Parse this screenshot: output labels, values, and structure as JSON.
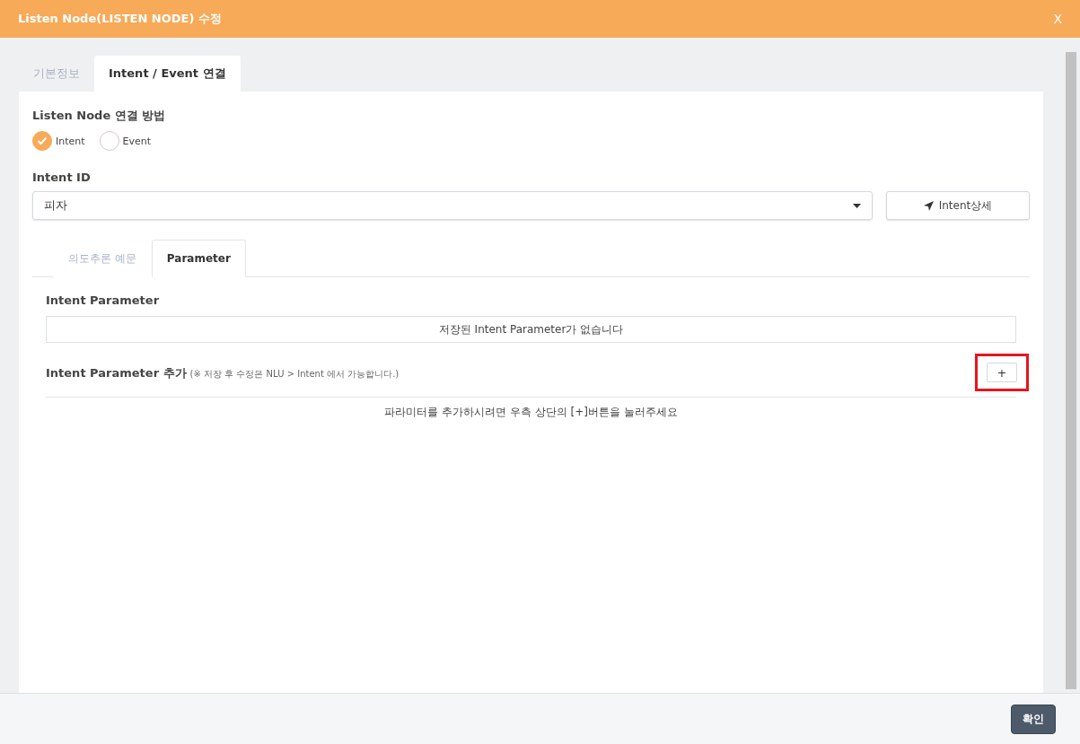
{
  "window": {
    "title": "Listen Node(LISTEN NODE) 수정",
    "close": "X"
  },
  "tabs": [
    {
      "label": "기본정보",
      "selected": false
    },
    {
      "label": "Intent / Event 연결",
      "selected": true
    }
  ],
  "connection": {
    "label": "Listen Node 연결 방법",
    "options": [
      {
        "label": "Intent",
        "selected": true
      },
      {
        "label": "Event",
        "selected": false
      }
    ]
  },
  "intent_id": {
    "label": "Intent ID",
    "value": "피자",
    "detail_button": "Intent상세"
  },
  "sub_tabs": [
    {
      "label": "의도추론 예문",
      "selected": false
    },
    {
      "label": "Parameter",
      "selected": true
    }
  ],
  "parameters": {
    "title": "Intent Parameter",
    "empty_message": "저장된 Intent Parameter가 없습니다"
  },
  "add_parameter": {
    "title": "Intent Parameter 추가",
    "note": "(※ 저장 후 수정은 NLU > Intent 에서 가능합니다.)",
    "add_button": "+",
    "hint": "파라미터를 추가하시려면 우측 상단의 [+]버튼을 눌러주세요"
  },
  "footer": {
    "confirm_button": "확인"
  }
}
